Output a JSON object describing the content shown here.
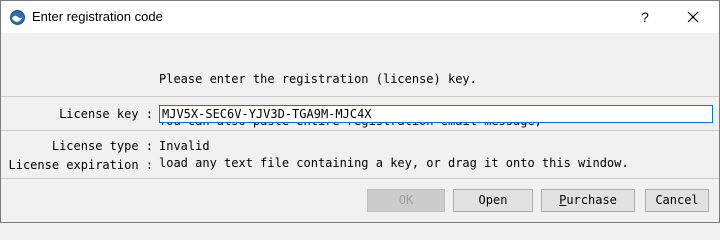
{
  "window": {
    "title": "Enter registration code",
    "help_label": "?",
    "close_icon": "close-icon"
  },
  "info": {
    "line1": "Please enter the registration (license) key.",
    "line2": "You can also paste entire registration email message,",
    "line3": "load any text file containing a key, or drag it onto this window."
  },
  "license_key": {
    "label": "License key :",
    "value": "MJV5X-SEC6V-YJV3D-TGA9M-MJC4X"
  },
  "license_type": {
    "label": "License type :",
    "value": "Invalid"
  },
  "license_expiration": {
    "label": "License expiration :",
    "value": ""
  },
  "buttons": {
    "ok": "OK",
    "open": "Open",
    "purchase_first": "P",
    "purchase_rest": "urchase",
    "cancel": "Cancel"
  },
  "colors": {
    "accent": "#0078d7",
    "button_face": "#e1e1e1",
    "dialog_bg": "#f0f0f0"
  }
}
